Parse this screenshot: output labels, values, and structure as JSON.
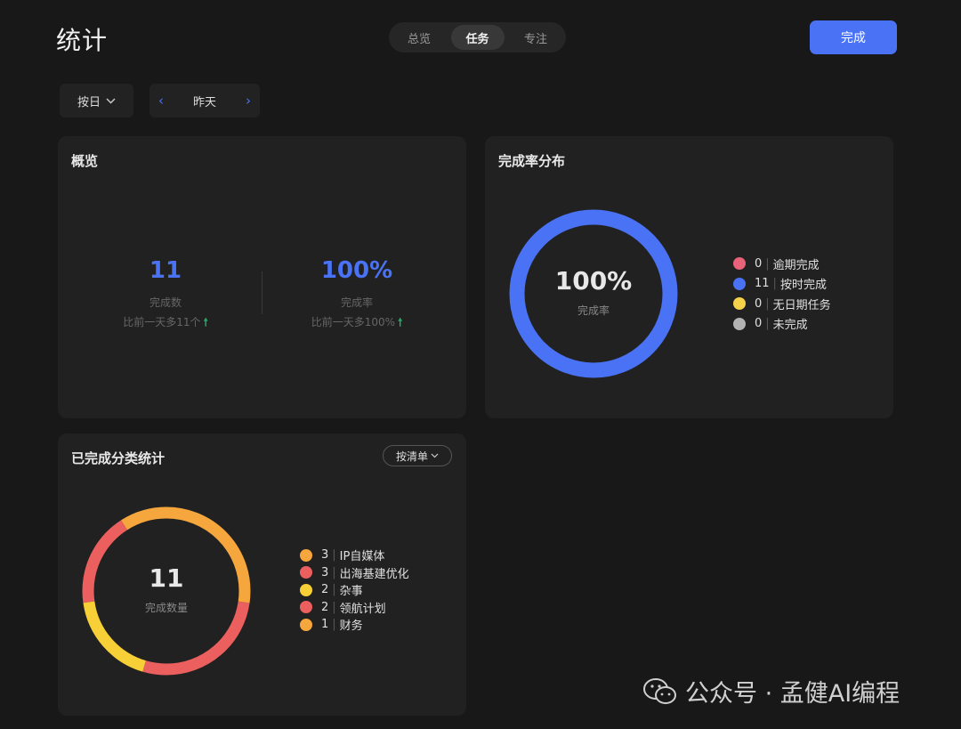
{
  "header": {
    "title": "统计",
    "tabs": [
      {
        "label": "总览",
        "active": false
      },
      {
        "label": "任务",
        "active": true
      },
      {
        "label": "专注",
        "active": false
      }
    ],
    "done_label": "完成"
  },
  "filters": {
    "range_label": "按日",
    "date_label": "昨天"
  },
  "overview": {
    "title": "概览",
    "count_value": "11",
    "count_label": "完成数",
    "count_compare": "比前一天多11个",
    "rate_value": "100%",
    "rate_label": "完成率",
    "rate_compare": "比前一天多100%"
  },
  "distribution": {
    "title": "完成率分布",
    "center_value": "100%",
    "center_label": "完成率",
    "legend": [
      {
        "count": "0",
        "label": "逾期完成",
        "color": "#e8637a"
      },
      {
        "count": "11",
        "label": "按时完成",
        "color": "#4a72f5"
      },
      {
        "count": "0",
        "label": "无日期任务",
        "color": "#f5d24a"
      },
      {
        "count": "0",
        "label": "未完成",
        "color": "#b3b3b3"
      }
    ]
  },
  "category": {
    "title": "已完成分类统计",
    "filter_label": "按清单",
    "center_value": "11",
    "center_label": "完成数量",
    "legend": [
      {
        "count": "3",
        "label": "IP自媒体",
        "color": "#f5a63c"
      },
      {
        "count": "3",
        "label": "出海基建优化",
        "color": "#ec5f5f"
      },
      {
        "count": "2",
        "label": "杂事",
        "color": "#f7cf36"
      },
      {
        "count": "2",
        "label": "领航计划",
        "color": "#ec5f5f"
      },
      {
        "count": "1",
        "label": "财务",
        "color": "#f5a63c"
      }
    ]
  },
  "watermark": {
    "text": "公众号 · 孟健AI编程"
  },
  "colors": {
    "accent": "#4a72f5",
    "up_arrow": "#2aa86b"
  }
}
